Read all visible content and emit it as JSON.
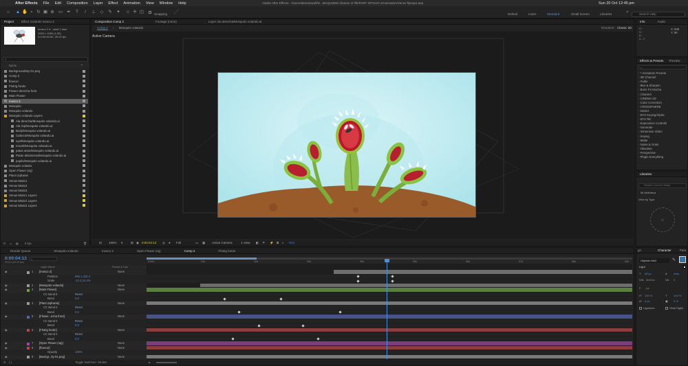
{
  "menubar": {
    "app": "After Effects",
    "items": [
      "File",
      "Edit",
      "Composition",
      "Layer",
      "Effect",
      "Animation",
      "View",
      "Window",
      "Help"
    ],
    "title": "Adobe After Effects - /Users/alemanwolf/D...MAQUSEM Jilusme of life/PART 2/FOLIO 2/Animation/Venus flytrap1.aep",
    "clock": "Sun 20 Oct  12:45 pm"
  },
  "toolbar": {
    "snapping": "Snapping",
    "workspaces": [
      "Default",
      "Learn",
      "Standard",
      "Small Screen",
      "Libraries"
    ],
    "active_workspace": "Standard",
    "search_placeholder": "Search Help"
  },
  "project": {
    "tabs": [
      "Project",
      "Effect Controls mosco 2"
    ],
    "thumb_name": "mosco 2",
    "thumb_info": [
      "mosco 2 ▾ , used 1 time",
      "1920 x 1080 (1.00)",
      "Δ 0:00:00:00, 25.00 fps"
    ],
    "search_placeholder": "",
    "header_name": "Name",
    "items": [
      {
        "name": "Backgroundsky-01.png",
        "color": "#9a9a9a",
        "indent": 0
      },
      {
        "name": "Comp 2",
        "color": "#9a9a9a",
        "indent": 0
      },
      {
        "name": "flowcor",
        "color": "#9a9a9a",
        "indent": 0
      },
      {
        "name": "Flotrig fondo",
        "color": "#9a9a9a",
        "indent": 0
      },
      {
        "name": "Flower derecha front",
        "color": "#9a9a9a",
        "indent": 0
      },
      {
        "name": "Main Flower",
        "color": "#9a9a9a",
        "indent": 0
      },
      {
        "name": "mosco 2",
        "color": "#9a9a9a",
        "indent": 0,
        "selected": true
      },
      {
        "name": "Mosquito",
        "color": "#9a9a9a",
        "indent": 0
      },
      {
        "name": "Mosquito volando",
        "color": "#9a9a9a",
        "indent": 0
      },
      {
        "name": "Mosquito volando Layers",
        "color": "#d4c94a",
        "indent": 0,
        "folder": true
      },
      {
        "name": "Ala derecha/Mosquito volando.ai",
        "color": "#9a9a9a",
        "indent": 1
      },
      {
        "name": "Ala izq/Mosquito volando.ai",
        "color": "#9a9a9a",
        "indent": 1
      },
      {
        "name": "Body/Mosquito volando.ai",
        "color": "#9a9a9a",
        "indent": 1
      },
      {
        "name": "Cabeza/Mosquito volando.ai",
        "color": "#9a9a9a",
        "indent": 1
      },
      {
        "name": "eyel/Mosquito volando.ai",
        "color": "#9a9a9a",
        "indent": 1
      },
      {
        "name": "mouth/Mosquito volando.ai",
        "color": "#9a9a9a",
        "indent": 1
      },
      {
        "name": "patas atras/Mosquito volando.ai",
        "color": "#9a9a9a",
        "indent": 1
      },
      {
        "name": "Patas delanteras/Mosquito volando.ai",
        "color": "#9a9a9a",
        "indent": 1
      },
      {
        "name": "pupila/Mosquito volando.ai",
        "color": "#9a9a9a",
        "indent": 1
      },
      {
        "name": "Mosquito volador",
        "color": "#9a9a9a",
        "indent": 0
      },
      {
        "name": "Open Flower (sq)",
        "color": "#9a9a9a",
        "indent": 0
      },
      {
        "name": "Plant izqfrante",
        "color": "#9a9a9a",
        "indent": 0
      },
      {
        "name": "Venus Matic1",
        "color": "#9a9a9a",
        "indent": 0
      },
      {
        "name": "Venus Matic2",
        "color": "#9a9a9a",
        "indent": 0
      },
      {
        "name": "Venus Matic3",
        "color": "#9a9a9a",
        "indent": 0
      },
      {
        "name": "Venus Matic1 Layers",
        "color": "#d4c94a",
        "indent": 0,
        "folder": true
      },
      {
        "name": "Venus Matic2 Layers",
        "color": "#d4c94a",
        "indent": 0,
        "folder": true
      },
      {
        "name": "Venus Matic3 Layers",
        "color": "#d4c94a",
        "indent": 0,
        "folder": true
      }
    ],
    "footer_bpc": "8 bpc"
  },
  "viewer": {
    "tabs": [
      "Composition Comp 2",
      "Footage (none)",
      "Layer Ala derecha/Mosquito volando.ai"
    ],
    "subtabs": [
      "Comp 2",
      "Mosquito volando"
    ],
    "renderer_label": "Renderer:",
    "renderer": "Classic 3D",
    "active_camera": "Active Camera",
    "bottom": {
      "zoom": "100%",
      "timecode": "0:00:04:13",
      "resolution": "Full",
      "camera": "Active Camera",
      "view": "1 View",
      "exposure": "+0.0"
    }
  },
  "right": {
    "info_tabs": [
      "Info",
      "Audio"
    ],
    "info_x": "X: 848",
    "info_y": "Y: 88",
    "fx_tabs": [
      "Effects & Presets",
      "Preview"
    ],
    "fx_items": [
      "* Animation Presets",
      "3D Channel",
      "Audio",
      "Blur & Sharpen",
      "Boris FX Mocha",
      "Channel",
      "CINEMA 4D",
      "Color Correction",
      "CROSSPHERE",
      "Distort",
      "EFX Keying/Alpha",
      "EFX RE",
      "Expression Controls",
      "Generate",
      "Immersive Video",
      "Keying",
      "Matte",
      "Noise & Grain",
      "Obsolete",
      "Perspective",
      "Plugin Everything"
    ],
    "lib_tab": "Libraries",
    "lib_search": "Search Current Library",
    "lib_name": "Mi biblioteca",
    "lib_view": "View by Type"
  },
  "timeline": {
    "tabs": [
      "Render Queue",
      "Mosquito volando",
      "mosco 2",
      "Open Flower (sq)",
      "Comp 2",
      "Flotrig fondo"
    ],
    "active_tab": "Comp 2",
    "timecode": "0:00:04:13",
    "timecode_sub": "00113 (25.00 fps)",
    "header": {
      "name": "Layer Name",
      "parent": "Parent & Link"
    },
    "ruler": [
      "0:00s",
      "01s",
      "02s",
      "03s",
      "04s",
      "05s",
      "06s",
      "07s",
      "08s",
      "09s"
    ],
    "footer": "Toggle Switches / Modes",
    "rows": [
      {
        "num": "1",
        "name": "[mosco 2]",
        "color": "#9a9a9a",
        "parent": "None",
        "indent": 0
      },
      {
        "num": "",
        "name": "Position",
        "value": "966.1,432.4",
        "indent": 2
      },
      {
        "num": "",
        "name": "Scale",
        "value": "-12.4,13.4%",
        "indent": 2
      },
      {
        "num": "2",
        "name": "[Mosquito volando]",
        "color": "#9a9a9a",
        "parent": "None",
        "indent": 0
      },
      {
        "num": "3",
        "name": "[Main Flower]",
        "color": "#6fa04a",
        "parent": "None",
        "indent": 0
      },
      {
        "num": "",
        "name": "CC Bend It",
        "value": "Reset",
        "indent": 1
      },
      {
        "num": "",
        "name": "Bend",
        "value": "0.0",
        "indent": 2
      },
      {
        "num": "4",
        "name": "[Plant izqfrante]",
        "color": "#9a9a9a",
        "parent": "None",
        "indent": 0
      },
      {
        "num": "",
        "name": "CC Bend It",
        "value": "Reset",
        "indent": 1
      },
      {
        "num": "",
        "name": "Bend",
        "value": "0.0",
        "indent": 2
      },
      {
        "num": "5",
        "name": "[Flower...echa front]",
        "color": "#5566aa",
        "parent": "None",
        "indent": 0
      },
      {
        "num": "",
        "name": "CC Bend It",
        "value": "Reset",
        "indent": 1
      },
      {
        "num": "",
        "name": "Bend",
        "value": "0.0",
        "indent": 2
      },
      {
        "num": "6",
        "name": "[Flotrig fondo]",
        "color": "#b04a4a",
        "parent": "None",
        "indent": 0
      },
      {
        "num": "",
        "name": "CC Bend It",
        "value": "Reset",
        "indent": 1
      },
      {
        "num": "",
        "name": "Bend",
        "value": "0.0",
        "indent": 2
      },
      {
        "num": "7",
        "name": "[Open Flower (sq)]",
        "color": "#9a4aa0",
        "parent": "None",
        "indent": 0
      },
      {
        "num": "8",
        "name": "[flowcor]",
        "color": "#b04a4a",
        "parent": "None",
        "indent": 0
      },
      {
        "num": "",
        "name": "Opacity",
        "value": "100%",
        "indent": 2
      },
      {
        "num": "9",
        "name": "[Backgr...ky-01.png]",
        "color": "#9a9a9a",
        "parent": "None",
        "indent": 0
      }
    ]
  },
  "character": {
    "tabs": [
      "Character",
      "Para"
    ],
    "font": "Objektiv Mk3",
    "style": "Light",
    "size": "48 px",
    "leading": "Auto",
    "kerning": "Metrics",
    "tracking": "0",
    "stroke": "- px",
    "vscale": "100 %",
    "hscale": "100 %",
    "baseline": "0 px",
    "tsume": "0 %",
    "ligatures": "Ligatures",
    "hindi": "Hindi Digits"
  }
}
